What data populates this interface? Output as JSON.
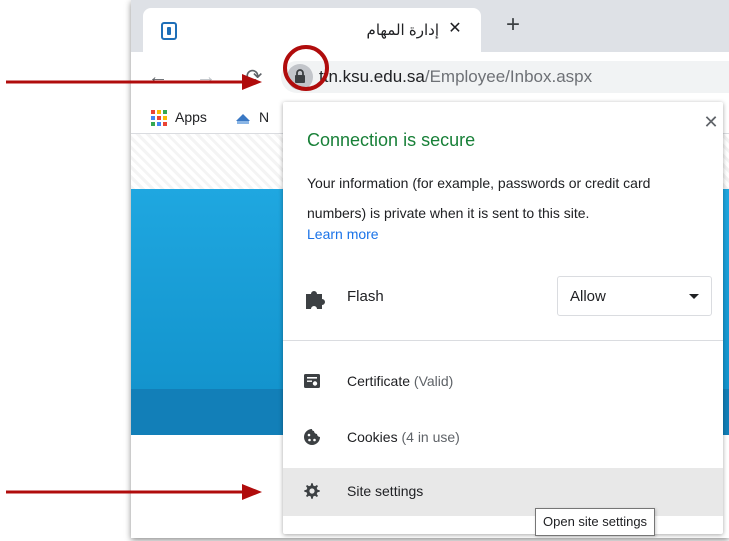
{
  "browser": {
    "tab": {
      "title": "إدارة المهام",
      "close_glyph": "✕"
    },
    "new_tab_glyph": "+",
    "toolbar": {
      "back_glyph": "←",
      "forward_glyph": "→",
      "reload_glyph": "⟳",
      "url_host": "ttn.ksu.edu.sa",
      "url_path": "/Employee/Inbox.aspx"
    },
    "bookmarks": {
      "apps_label": "Apps",
      "second_label": "N"
    }
  },
  "site_info_popup": {
    "title": "Connection is secure",
    "close_glyph": "✕",
    "description": "Your information (for example, passwords or credit card numbers) is private when it is sent to this site.",
    "learn_more": "Learn more",
    "flash": {
      "label": "Flash",
      "selected": "Allow"
    },
    "items": [
      {
        "label": "Certificate",
        "sub": "(Valid)",
        "icon": "certificate-icon"
      },
      {
        "label": "Cookies",
        "sub": "(4 in use)",
        "icon": "cookie-icon"
      },
      {
        "label": "Site settings",
        "sub": "",
        "icon": "gear-icon"
      }
    ]
  },
  "tooltip": "Open site settings",
  "colors": {
    "secure_green": "#188038",
    "link_blue": "#1a73e8",
    "annotation_red": "#b00c0c",
    "banner_blue": "#1fa7e0"
  }
}
